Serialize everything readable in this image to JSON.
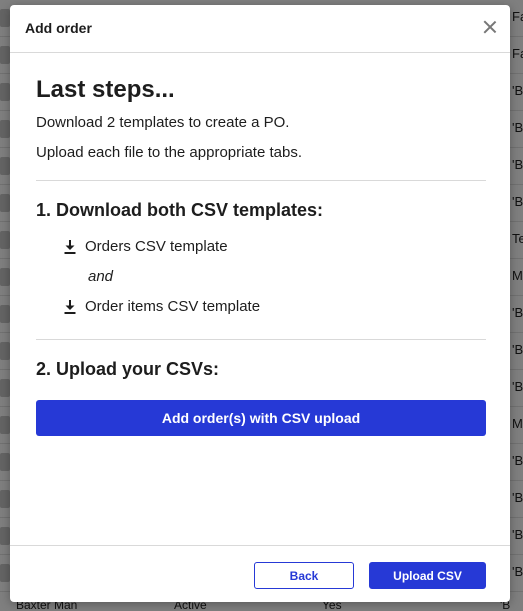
{
  "background": {
    "right_cells": [
      "Fa",
      "Fa",
      "'B",
      "'B",
      "'B",
      "'B",
      "Te",
      "Mo",
      "'B",
      "'B",
      "'B",
      "Mo",
      "'B",
      "'B",
      "'B",
      "'B"
    ],
    "bottom": {
      "name": "Baxter Man",
      "status": "Active",
      "flag": "Yes",
      "right": "'B"
    }
  },
  "modal": {
    "title": "Add order",
    "heading": "Last steps...",
    "line1": "Download 2 templates to create a PO.",
    "line2": "Upload each file to the appropriate tabs.",
    "step1_title": "1. Download both CSV templates:",
    "link_orders": "Orders CSV template",
    "and_text": "and",
    "link_order_items": "Order items CSV template",
    "step2_title": "2. Upload your CSVs:",
    "upload_button": "Add order(s) with CSV upload",
    "back_button": "Back",
    "upload_csv_button": "Upload CSV"
  },
  "colors": {
    "primary": "#2639d6",
    "overlay": "rgba(0,0,0,0.5)"
  }
}
